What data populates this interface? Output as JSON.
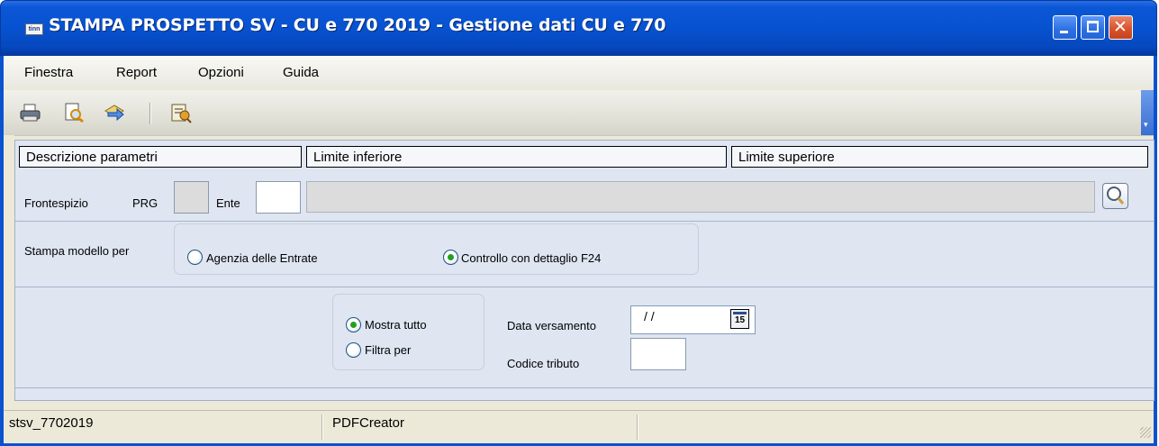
{
  "window": {
    "title": "STAMPA PROSPETTO SV - CU e 770 2019 - Gestione dati CU e 770",
    "logo_text": "tinn"
  },
  "menu": {
    "items": [
      {
        "label": "Finestra"
      },
      {
        "label": "Report"
      },
      {
        "label": "Opzioni"
      },
      {
        "label": "Guida"
      }
    ]
  },
  "toolbar": {
    "icons": [
      "print-icon",
      "print-preview-icon",
      "export-icon",
      "report-settings-icon"
    ],
    "overflow_glyph": "▾"
  },
  "grid_header": {
    "col_description": "Descrizione parametri",
    "col_lower": "Limite inferiore",
    "col_upper": "Limite superiore"
  },
  "frontespizio": {
    "label": "Frontespizio",
    "prg_label": "PRG",
    "prg_value": "",
    "ente_label": "Ente",
    "ente_value": "",
    "description_value": ""
  },
  "stampa_modello": {
    "label": "Stampa modello per",
    "options": [
      {
        "label": "Agenzia delle Entrate",
        "selected": false
      },
      {
        "label": "Controllo con dettaglio F24",
        "selected": true
      }
    ]
  },
  "filtro": {
    "options": [
      {
        "label": "Mostra tutto",
        "selected": true
      },
      {
        "label": "Filtra per",
        "selected": false
      }
    ],
    "data_versamento_label": "Data versamento",
    "data_versamento_value": "/ /",
    "calendar_day": "15",
    "codice_tributo_label": "Codice tributo",
    "codice_tributo_value": ""
  },
  "statusbar": {
    "panel1": "stsv_7702019",
    "panel2": "PDFCreator",
    "panel3": ""
  },
  "colors": {
    "title_bar": "#0752d0",
    "content_bg": "#dfe6f1",
    "radio_dot": "#21a121"
  }
}
